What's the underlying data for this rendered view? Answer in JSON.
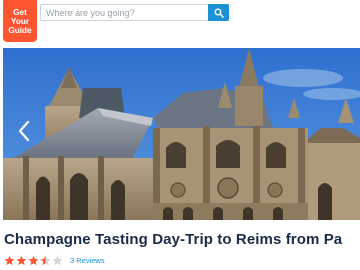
{
  "header": {
    "logo_lines": [
      "Get",
      "Your",
      "Guide"
    ],
    "search": {
      "value": "",
      "placeholder": "Where are you going?"
    }
  },
  "hero": {
    "image_subject": "Reims Cathedral",
    "nav_prev_icon": "chevron-left-icon"
  },
  "tour": {
    "title": "Champagne Tasting Day-Trip to Reims from Pa",
    "rating": 3.5,
    "rating_max": 5,
    "reviews_label": "3 Reviews"
  },
  "colors": {
    "brand": "#ff5533",
    "accent": "#1a91d2",
    "star": "#ff5533",
    "star_empty": "#d6d6d6",
    "title": "#1a2b49"
  }
}
